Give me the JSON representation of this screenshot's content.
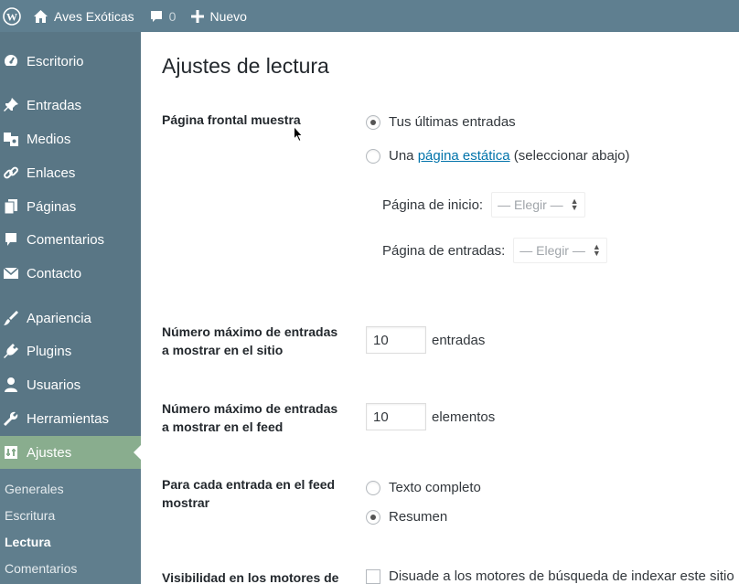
{
  "adminbar": {
    "site_name": "Aves Exóticas",
    "comments_count": "0",
    "new_label": "Nuevo"
  },
  "sidebar": {
    "items": [
      {
        "label": "Escritorio",
        "icon": "dashboard-icon"
      },
      {
        "label": "Entradas",
        "icon": "pin-icon"
      },
      {
        "label": "Medios",
        "icon": "media-icon"
      },
      {
        "label": "Enlaces",
        "icon": "links-icon"
      },
      {
        "label": "Páginas",
        "icon": "pages-icon"
      },
      {
        "label": "Comentarios",
        "icon": "comments-icon"
      },
      {
        "label": "Contacto",
        "icon": "mail-icon"
      },
      {
        "label": "Apariencia",
        "icon": "brush-icon"
      },
      {
        "label": "Plugins",
        "icon": "plugins-icon"
      },
      {
        "label": "Usuarios",
        "icon": "users-icon"
      },
      {
        "label": "Herramientas",
        "icon": "wrench-icon"
      },
      {
        "label": "Ajustes",
        "icon": "settings-icon"
      }
    ],
    "submenu": [
      "Generales",
      "Escritura",
      "Lectura",
      "Comentarios"
    ]
  },
  "page": {
    "title": "Ajustes de lectura",
    "front_page": {
      "label": "Página frontal muestra",
      "option_latest": "Tus últimas entradas",
      "option_static_prefix": "Una",
      "option_static_link": "página estática",
      "option_static_suffix": "(seleccionar abajo)",
      "selected": "latest",
      "home_label": "Página de inicio:",
      "posts_label": "Página de entradas:",
      "select_placeholder": "— Elegir —"
    },
    "posts_per_page": {
      "label_line1": "Número máximo de entradas",
      "label_line2": "a mostrar en el sitio",
      "value": "10",
      "unit": "entradas"
    },
    "feed_items": {
      "label_line1": "Número máximo de entradas",
      "label_line2": "a mostrar en el feed",
      "value": "10",
      "unit": "elementos"
    },
    "feed_content": {
      "label_line1": "Para cada entrada en el feed",
      "label_line2": "mostrar",
      "option_full": "Texto completo",
      "option_summary": "Resumen",
      "selected": "summary"
    },
    "visibility": {
      "label": "Visibilidad en los motores de",
      "checkbox_label": "Disuade a los motores de búsqueda de indexar este sitio",
      "checked": false
    }
  }
}
